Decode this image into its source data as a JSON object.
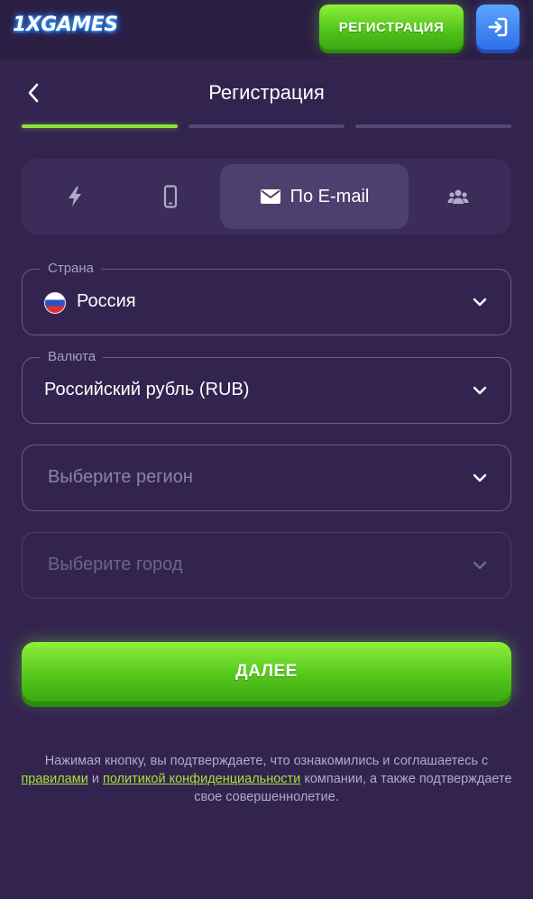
{
  "topbar": {
    "logo_text": "1XGAMES",
    "register_label": "РЕГИСТРАЦИЯ",
    "login_icon": "sign-in-icon"
  },
  "header": {
    "back_icon": "chevron-left-icon",
    "title": "Регистрация"
  },
  "steps": [
    {
      "state": "active"
    },
    {
      "state": "inactive"
    },
    {
      "state": "inactive"
    }
  ],
  "methods": [
    {
      "icon": "lightning-icon",
      "label": "",
      "active": false
    },
    {
      "icon": "phone-icon",
      "label": "",
      "active": false
    },
    {
      "icon": "envelope-icon",
      "label": "По E-mail",
      "active": true
    },
    {
      "icon": "users-icon",
      "label": "",
      "active": false
    }
  ],
  "form": {
    "country": {
      "legend": "Страна",
      "value": "Россия",
      "flag": "russia-flag-icon"
    },
    "currency": {
      "legend": "Валюта",
      "value": "Российский рубль (RUB)"
    },
    "region": {
      "placeholder": "Выберите регион"
    },
    "city": {
      "placeholder": "Выберите город"
    }
  },
  "next_button": {
    "label": "ДАЛЕЕ"
  },
  "legal": {
    "text_1": "Нажимая кнопку, вы подтверждаете, что ознакомились и соглашаетесь с",
    "link_rules": "правилами",
    "text_2": "и",
    "link_privacy": "политикой конфиденциальности",
    "text_3": "компании, а также подтверждаете свое совершеннолетие."
  },
  "colors": {
    "background": "#33244f",
    "topbar": "#2b1e43",
    "accent_green": "#8fe23a",
    "login_blue": "#2f6fe8",
    "link_green": "#a6e23b"
  }
}
